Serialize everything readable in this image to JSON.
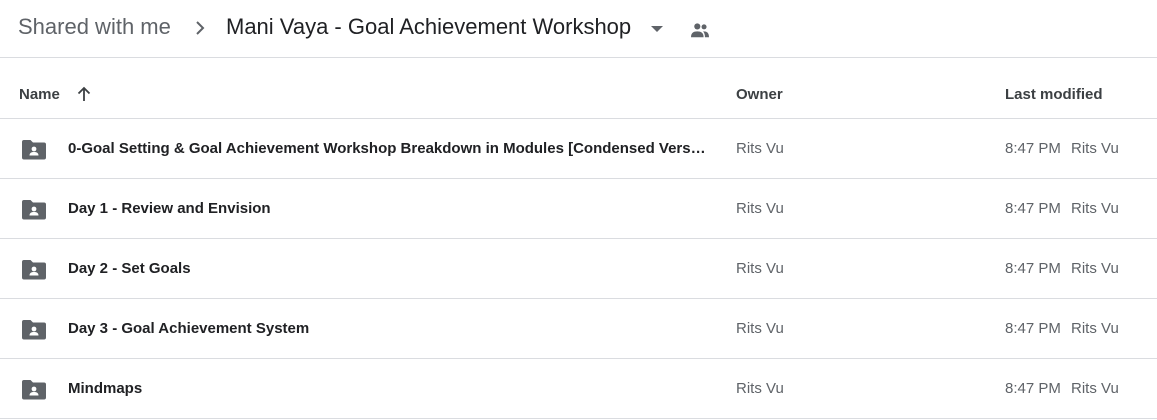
{
  "breadcrumb": {
    "root": "Shared with me",
    "current": "Mani Vaya - Goal Achievement Workshop"
  },
  "icons": {
    "separator": "chevron-right-icon",
    "dropdown": "caret-down-icon",
    "shared": "people-icon",
    "sort": "arrow-up-icon",
    "folder": "shared-folder-icon"
  },
  "columns": {
    "name": "Name",
    "owner": "Owner",
    "last_modified": "Last modified"
  },
  "sort": {
    "column": "Name",
    "direction": "ascending"
  },
  "files": [
    {
      "name": "0-Goal Setting & Goal Achievement Workshop Breakdown in Modules [Condensed Vers…",
      "owner": "Rits Vu",
      "modified_time": "8:47 PM",
      "modified_by": "Rits Vu"
    },
    {
      "name": "Day 1 - Review and Envision",
      "owner": "Rits Vu",
      "modified_time": "8:47 PM",
      "modified_by": "Rits Vu"
    },
    {
      "name": "Day 2 - Set Goals",
      "owner": "Rits Vu",
      "modified_time": "8:47 PM",
      "modified_by": "Rits Vu"
    },
    {
      "name": "Day 3 - Goal Achievement System",
      "owner": "Rits Vu",
      "modified_time": "8:47 PM",
      "modified_by": "Rits Vu"
    },
    {
      "name": "Mindmaps",
      "owner": "Rits Vu",
      "modified_time": "8:47 PM",
      "modified_by": "Rits Vu"
    }
  ],
  "colors": {
    "icon_gray": "#5f6368",
    "divider": "#dadce0",
    "text_primary": "#202124"
  }
}
